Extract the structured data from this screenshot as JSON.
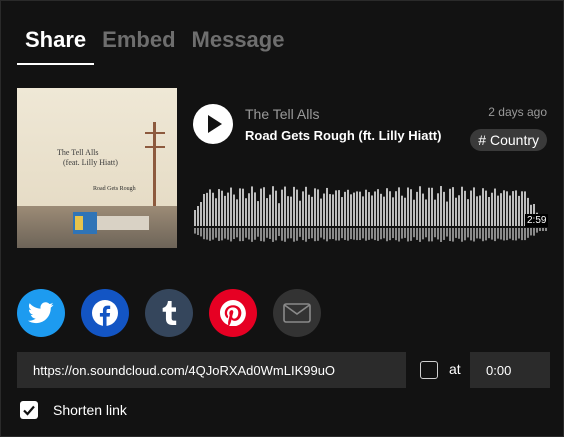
{
  "tabs": [
    {
      "label": "Share",
      "active": true
    },
    {
      "label": "Embed",
      "active": false
    },
    {
      "label": "Message",
      "active": false
    }
  ],
  "track": {
    "artist": "The Tell Alls",
    "title": "Road Gets Rough (ft. Lilly Hiatt)",
    "posted": "2 days ago",
    "tag": "# Country",
    "duration": "2:59",
    "artwork": {
      "title_line1": "The Tell Alls",
      "title_line2": "(feat. Lilly Hiatt)",
      "subtitle": "Road Gets Rough"
    },
    "play_icon": "play-icon"
  },
  "social": [
    {
      "name": "twitter",
      "icon": "twitter-icon",
      "color": "#1d9bf0"
    },
    {
      "name": "facebook",
      "icon": "facebook-icon",
      "color": "#1355c4"
    },
    {
      "name": "tumblr",
      "icon": "tumblr-icon",
      "color": "#35465c"
    },
    {
      "name": "pinterest",
      "icon": "pinterest-icon",
      "color": "#e60023"
    },
    {
      "name": "email",
      "icon": "email-icon",
      "color": "#333333"
    }
  ],
  "share": {
    "url": "https://on.soundcloud.com/4QJoRXAd0WmLIK99uO",
    "at_label": "at",
    "at_checked": false,
    "time_value": "0:00",
    "shorten_label": "Shorten link",
    "shorten_checked": true
  }
}
